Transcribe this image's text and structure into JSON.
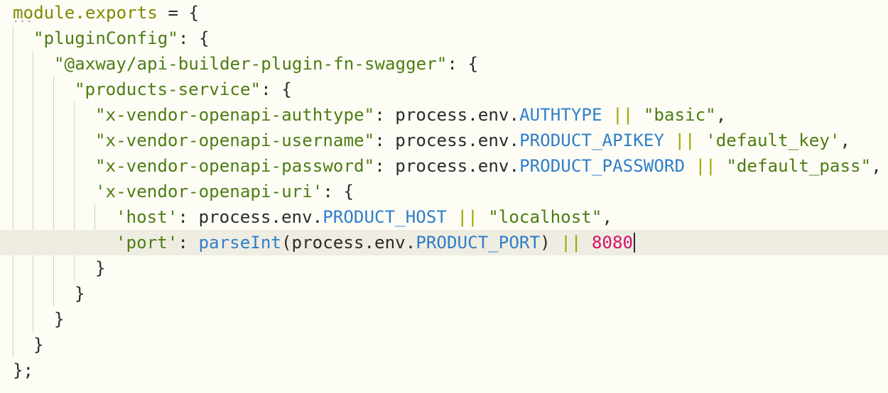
{
  "editor": {
    "fold_marker": "...",
    "lines": [
      [
        {
          "t": "module.exports",
          "c": "kw"
        },
        {
          "t": " = {",
          "c": "plain"
        }
      ],
      [
        {
          "t": "\"pluginConfig\"",
          "c": "str"
        },
        {
          "t": ": {",
          "c": "plain"
        }
      ],
      [
        {
          "t": "\"@axway/api-builder-plugin-fn-swagger\"",
          "c": "str"
        },
        {
          "t": ": {",
          "c": "plain"
        }
      ],
      [
        {
          "t": "\"products-service\"",
          "c": "str"
        },
        {
          "t": ": {",
          "c": "plain"
        }
      ],
      [
        {
          "t": "\"x-vendor-openapi-authtype\"",
          "c": "str"
        },
        {
          "t": ": process.env.",
          "c": "plain"
        },
        {
          "t": "AUTHTYPE",
          "c": "var"
        },
        {
          "t": " || ",
          "c": "op"
        },
        {
          "t": "\"basic\"",
          "c": "str"
        },
        {
          "t": ",",
          "c": "plain"
        }
      ],
      [
        {
          "t": "\"x-vendor-openapi-username\"",
          "c": "str"
        },
        {
          "t": ": process.env.",
          "c": "plain"
        },
        {
          "t": "PRODUCT_APIKEY",
          "c": "var"
        },
        {
          "t": " || ",
          "c": "op"
        },
        {
          "t": "'default_key'",
          "c": "str"
        },
        {
          "t": ",",
          "c": "plain"
        }
      ],
      [
        {
          "t": "\"x-vendor-openapi-password\"",
          "c": "str"
        },
        {
          "t": ": process.env.",
          "c": "plain"
        },
        {
          "t": "PRODUCT_PASSWORD",
          "c": "var"
        },
        {
          "t": " || ",
          "c": "op"
        },
        {
          "t": "\"default_pass\"",
          "c": "str"
        },
        {
          "t": ",",
          "c": "plain"
        }
      ],
      [
        {
          "t": "'x-vendor-openapi-uri'",
          "c": "str"
        },
        {
          "t": ": {",
          "c": "plain"
        }
      ],
      [
        {
          "t": "'host'",
          "c": "str"
        },
        {
          "t": ": process.env.",
          "c": "plain"
        },
        {
          "t": "PRODUCT_HOST",
          "c": "var"
        },
        {
          "t": " || ",
          "c": "op"
        },
        {
          "t": "\"localhost\"",
          "c": "str"
        },
        {
          "t": ",",
          "c": "plain"
        }
      ],
      [
        {
          "t": "'port'",
          "c": "str"
        },
        {
          "t": ": ",
          "c": "plain"
        },
        {
          "t": "parseInt",
          "c": "var"
        },
        {
          "t": "(process.env.",
          "c": "plain"
        },
        {
          "t": "PRODUCT_PORT",
          "c": "var"
        },
        {
          "t": ") ",
          "c": "plain"
        },
        {
          "t": "||",
          "c": "op"
        },
        {
          "t": " ",
          "c": "plain"
        },
        {
          "t": "8080",
          "c": "num"
        }
      ],
      [
        {
          "t": "}",
          "c": "plain"
        }
      ],
      [
        {
          "t": "}",
          "c": "plain"
        }
      ],
      [
        {
          "t": "}",
          "c": "plain"
        }
      ],
      [
        {
          "t": "}",
          "c": "plain"
        }
      ],
      [
        {
          "t": "};",
          "c": "plain"
        }
      ]
    ],
    "current_line": 9,
    "colors": {
      "background": "#fdfdf6",
      "current_line": "#efede2",
      "string": "#4e7d12",
      "variable": "#2f7fc9",
      "number": "#d4136b",
      "operator": "#9aa700",
      "keyword": "#7e8a00",
      "text": "#2b2b2b",
      "indent_guide": "#cfcfc5"
    }
  }
}
